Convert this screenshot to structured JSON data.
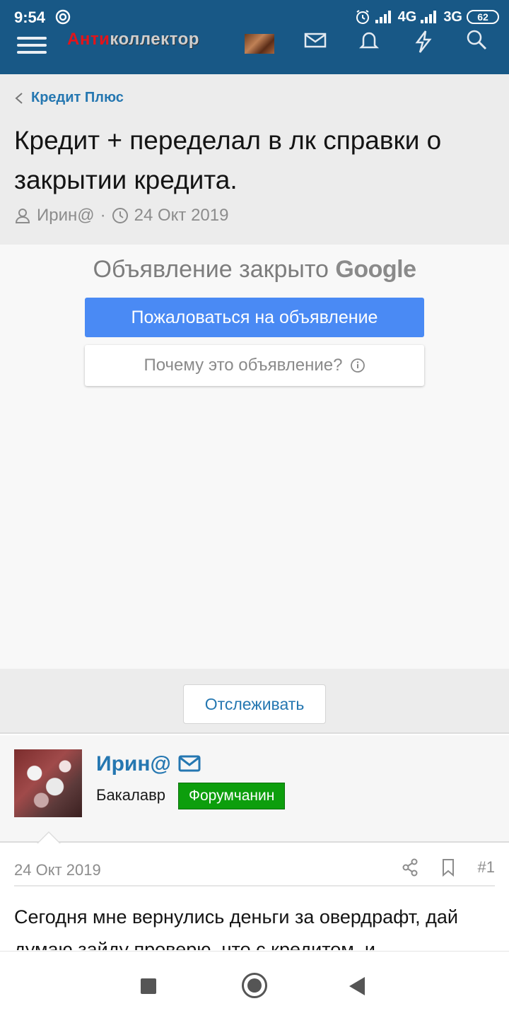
{
  "status_bar": {
    "time": "9:54",
    "network_1": "4G",
    "network_2": "3G",
    "battery": "62"
  },
  "app_bar": {
    "logo_part1": "Анти",
    "logo_part2": "коллектор"
  },
  "breadcrumb": "Кредит Плюс",
  "thread": {
    "title": "Кредит + переделал в лк справки о закрытии кредита.",
    "author": "Ирин@",
    "separator": "·",
    "date": "24 Окт 2019"
  },
  "ad": {
    "closed_text": "Объявление закрыто",
    "google": "Google",
    "report_button": "Пожаловаться на объявление",
    "why_button": "Почему это объявление?"
  },
  "watch_button": "Отслеживать",
  "post": {
    "username": "Ирин@",
    "rank": "Бакалавр",
    "badge": "Форумчанин",
    "date": "24 Окт 2019",
    "number": "#1",
    "body": "Сегодня мне вернулись деньги за овердрафт, дай думаю зайду проверю, что с кредитом, и"
  },
  "colors": {
    "header": "#185886",
    "link": "#2577b1",
    "badge": "#0d9e0d",
    "ad_button": "#4a8af4"
  }
}
